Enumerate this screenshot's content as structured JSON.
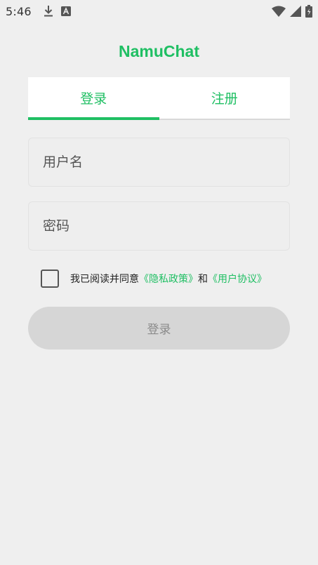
{
  "status_bar": {
    "time": "5:46",
    "left_icons": [
      "download-icon",
      "a-badge-icon"
    ],
    "right_icons": [
      "wifi-icon",
      "cell-signal-icon",
      "battery-icon"
    ]
  },
  "app": {
    "title": "NamuChat",
    "accent_color": "#1fbf63"
  },
  "tabs": [
    {
      "label": "登录",
      "active": true
    },
    {
      "label": "注册",
      "active": false
    }
  ],
  "form": {
    "username_placeholder": "用户名",
    "password_placeholder": "密码",
    "username_value": "",
    "password_value": ""
  },
  "agreement": {
    "checked": false,
    "prefix": "我已阅读并同意",
    "privacy_link": "《隐私政策》",
    "joiner": "和",
    "terms_link": "《用户协议》"
  },
  "login_button": {
    "label": "登录",
    "enabled": false
  }
}
